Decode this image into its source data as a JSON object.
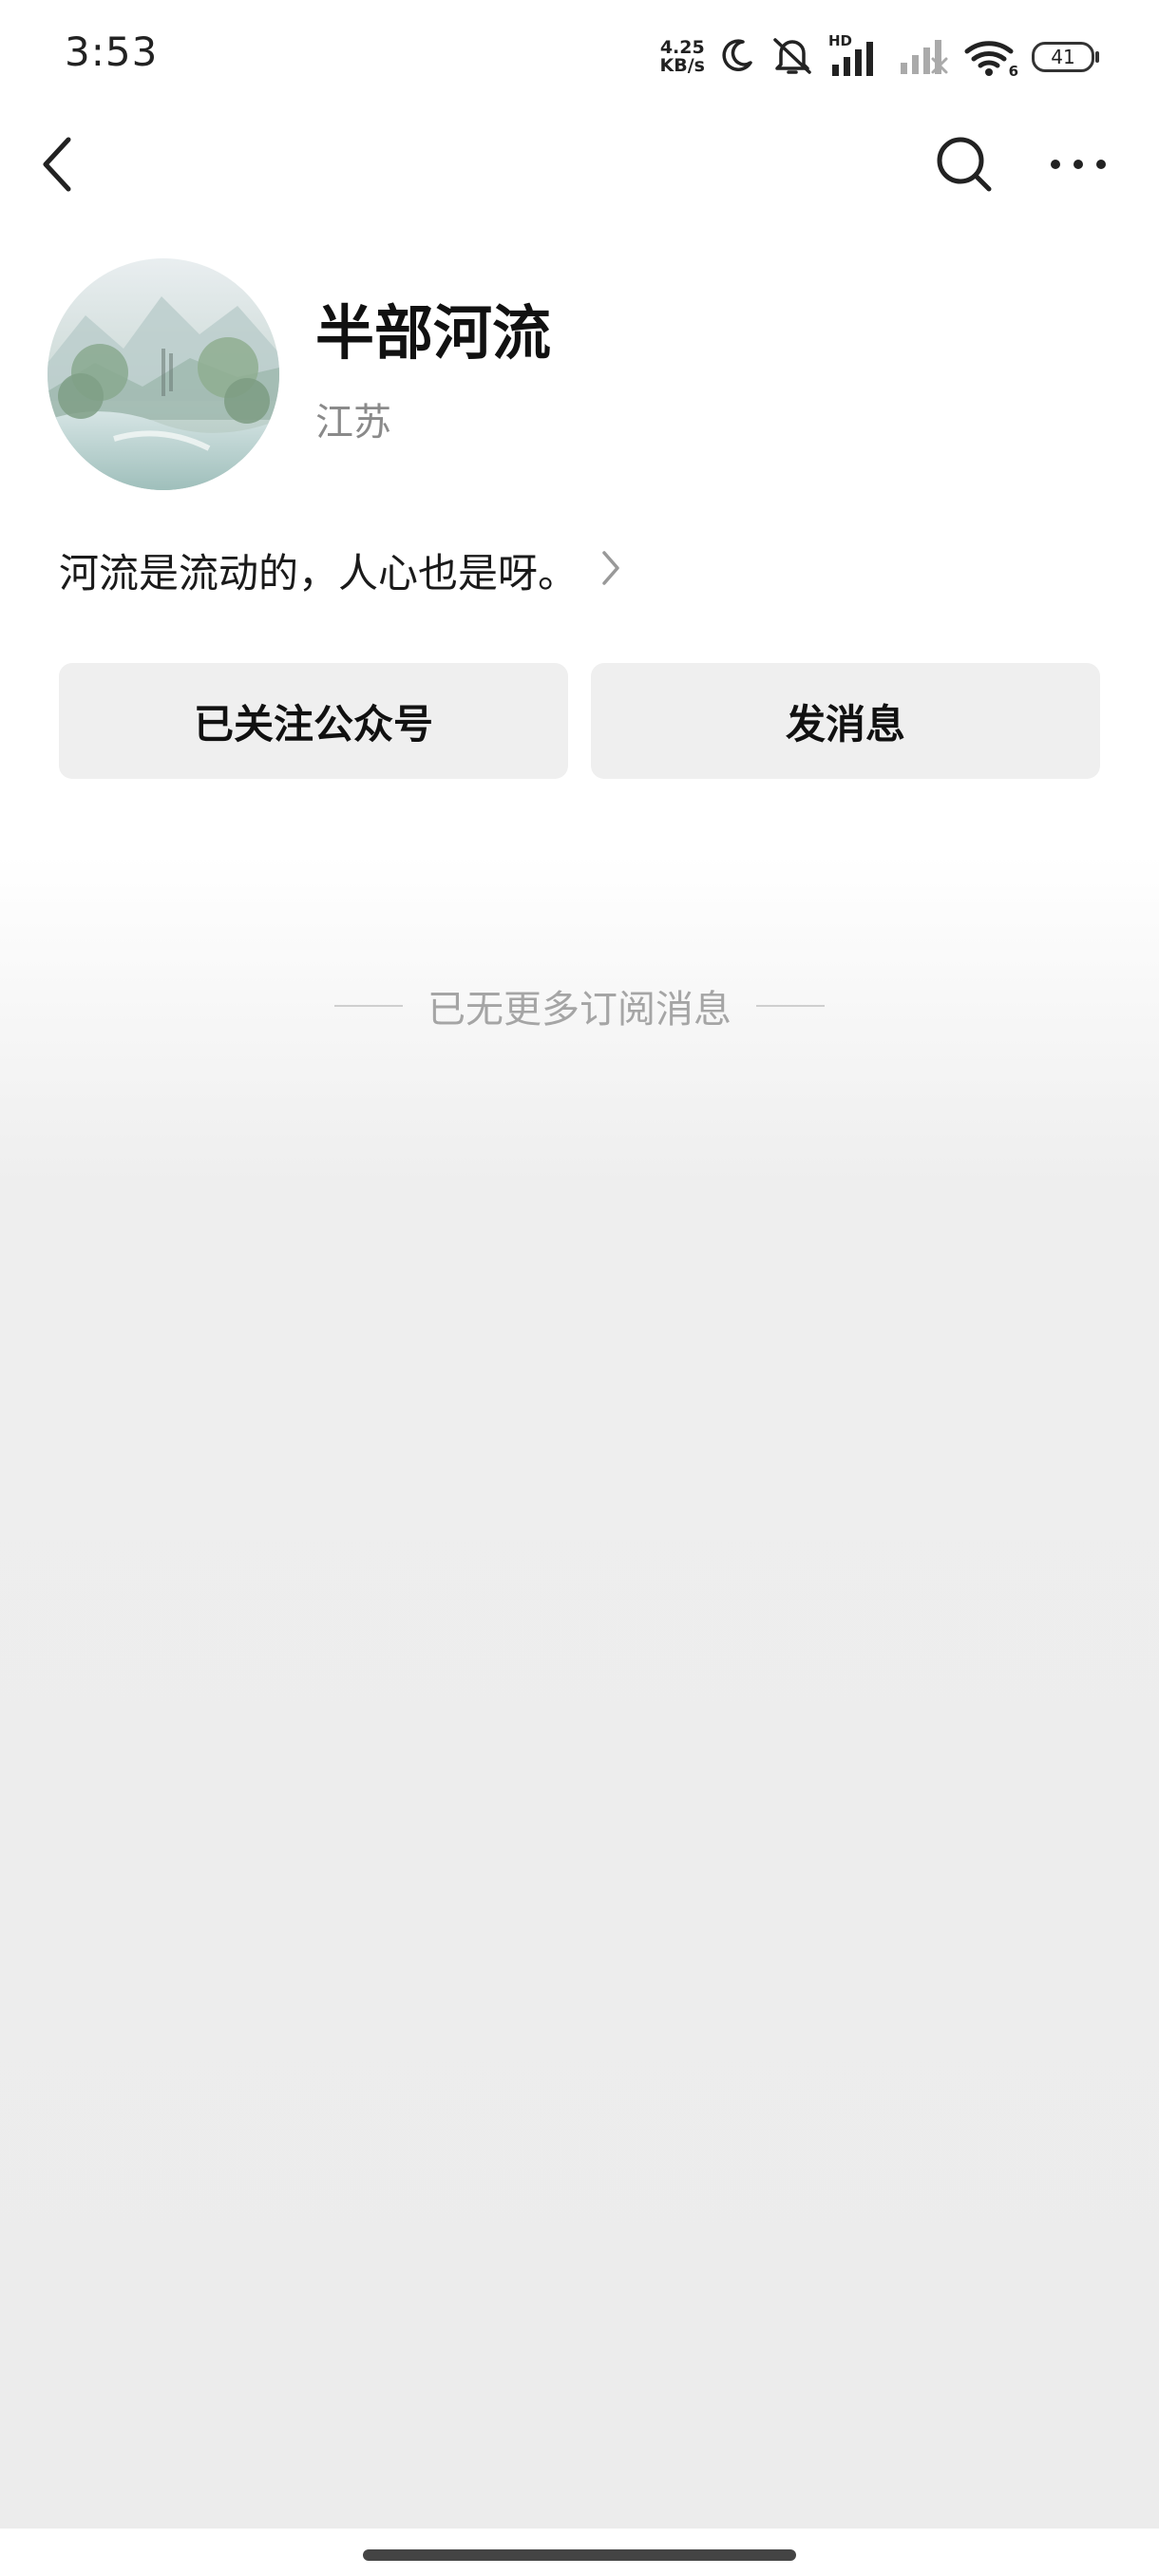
{
  "status_bar": {
    "time": "3:53",
    "net_speed_value": "4.25",
    "net_speed_unit": "KB/s",
    "hd_label": "HD",
    "wifi_sub": "6",
    "battery": "41"
  },
  "nav": {
    "back_icon": "chevron-left-icon",
    "search_icon": "search-icon",
    "more_icon": "more-horizontal-icon"
  },
  "profile": {
    "name": "半部河流",
    "region": "江苏",
    "description": "河流是流动的，人心也是呀。"
  },
  "actions": {
    "follow_label": "已关注公众号",
    "message_label": "发消息"
  },
  "feed": {
    "end_note": "已无更多订阅消息"
  },
  "colors": {
    "text_primary": "#111111",
    "text_secondary": "#8a8a8a",
    "button_bg": "#efefef",
    "page_bg_bottom": "#ececec"
  }
}
